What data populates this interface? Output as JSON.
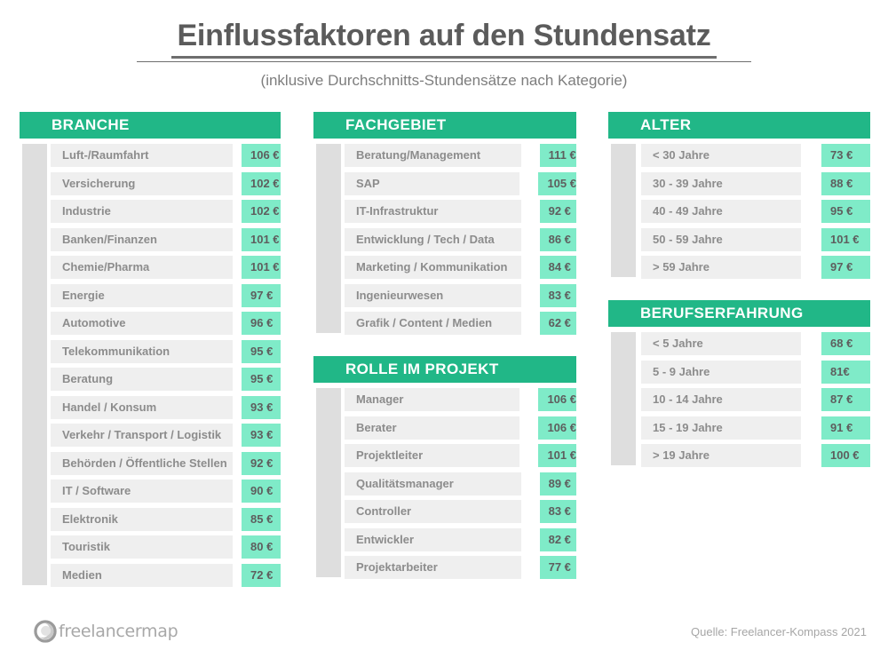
{
  "header": {
    "title": "Einflussfaktoren auf den Stundensatz",
    "subtitle": "(inklusive Durchschnitts-Stundensätze nach Kategorie)"
  },
  "colors": {
    "header_green": "#21b787",
    "value_mint": "#7febc8",
    "row_gray": "#efefef",
    "side_bar_gray": "#dedede",
    "text_gray": "#8c8c8c"
  },
  "footer": {
    "logo_text": "freelancermap",
    "logo_icon": "freelancermap-circle-logo",
    "source": "Quelle: Freelancer-Kompass 2021"
  },
  "columns": [
    {
      "id": "column-1",
      "groups": [
        {
          "id": "branche",
          "title": "BRANCHE",
          "rows": [
            {
              "label": "Luft-/Raumfahrt",
              "value": "106 €"
            },
            {
              "label": "Versicherung",
              "value": "102 €"
            },
            {
              "label": "Industrie",
              "value": "102 €"
            },
            {
              "label": "Banken/Finanzen",
              "value": "101 €"
            },
            {
              "label": "Chemie/Pharma",
              "value": "101 €"
            },
            {
              "label": "Energie",
              "value": "97 €"
            },
            {
              "label": "Automotive",
              "value": "96 €"
            },
            {
              "label": "Telekommunikation",
              "value": "95 €"
            },
            {
              "label": "Beratung",
              "value": "95 €"
            },
            {
              "label": "Handel / Konsum",
              "value": "93 €"
            },
            {
              "label": "Verkehr / Transport / Logistik",
              "value": "93 €"
            },
            {
              "label": "Behörden / Öffentliche Stellen",
              "value": "92 €"
            },
            {
              "label": "IT / Software",
              "value": "90 €"
            },
            {
              "label": "Elektronik",
              "value": "85 €"
            },
            {
              "label": "Touristik",
              "value": "80 €"
            },
            {
              "label": "Medien",
              "value": "72 €"
            }
          ]
        }
      ]
    },
    {
      "id": "column-2",
      "groups": [
        {
          "id": "fachgebiet",
          "title": "FACHGEBIET",
          "rows": [
            {
              "label": "Beratung/Management",
              "value": "111 €"
            },
            {
              "label": "SAP",
              "value": "105 €"
            },
            {
              "label": "IT-Infrastruktur",
              "value": "92 €"
            },
            {
              "label": "Entwicklung / Tech / Data",
              "value": "86 €"
            },
            {
              "label": "Marketing / Kommunikation",
              "value": "84 €"
            },
            {
              "label": "Ingenieurwesen",
              "value": "83 €"
            },
            {
              "label": "Grafik / Content / Medien",
              "value": "62 €"
            }
          ]
        },
        {
          "id": "rolle-im-projekt",
          "title": "ROLLE IM PROJEKT",
          "rows": [
            {
              "label": "Manager",
              "value": "106 €"
            },
            {
              "label": "Berater",
              "value": "106 €"
            },
            {
              "label": "Projektleiter",
              "value": "101 €"
            },
            {
              "label": "Qualitätsmanager",
              "value": "89 €"
            },
            {
              "label": "Controller",
              "value": "83 €"
            },
            {
              "label": "Entwickler",
              "value": "82 €"
            },
            {
              "label": "Projektarbeiter",
              "value": "77 €"
            }
          ]
        }
      ]
    },
    {
      "id": "column-3",
      "groups": [
        {
          "id": "alter",
          "title": "ALTER",
          "rows": [
            {
              "label": "< 30 Jahre",
              "value": "73 €"
            },
            {
              "label": "30 - 39 Jahre",
              "value": "88 €"
            },
            {
              "label": "40 - 49 Jahre",
              "value": "95 €"
            },
            {
              "label": "50 - 59 Jahre",
              "value": "101 €"
            },
            {
              "label": "> 59 Jahre",
              "value": "97 €"
            }
          ]
        },
        {
          "id": "berufserfahrung",
          "title": "BERUFSERFAHRUNG",
          "rows": [
            {
              "label": "< 5 Jahre",
              "value": "68 €"
            },
            {
              "label": "5 - 9 Jahre",
              "value": "81€"
            },
            {
              "label": "10 - 14 Jahre",
              "value": "87 €"
            },
            {
              "label": "15 - 19 Jahre",
              "value": "91 €"
            },
            {
              "label": "> 19 Jahre",
              "value": "100 €"
            }
          ]
        }
      ]
    }
  ]
}
